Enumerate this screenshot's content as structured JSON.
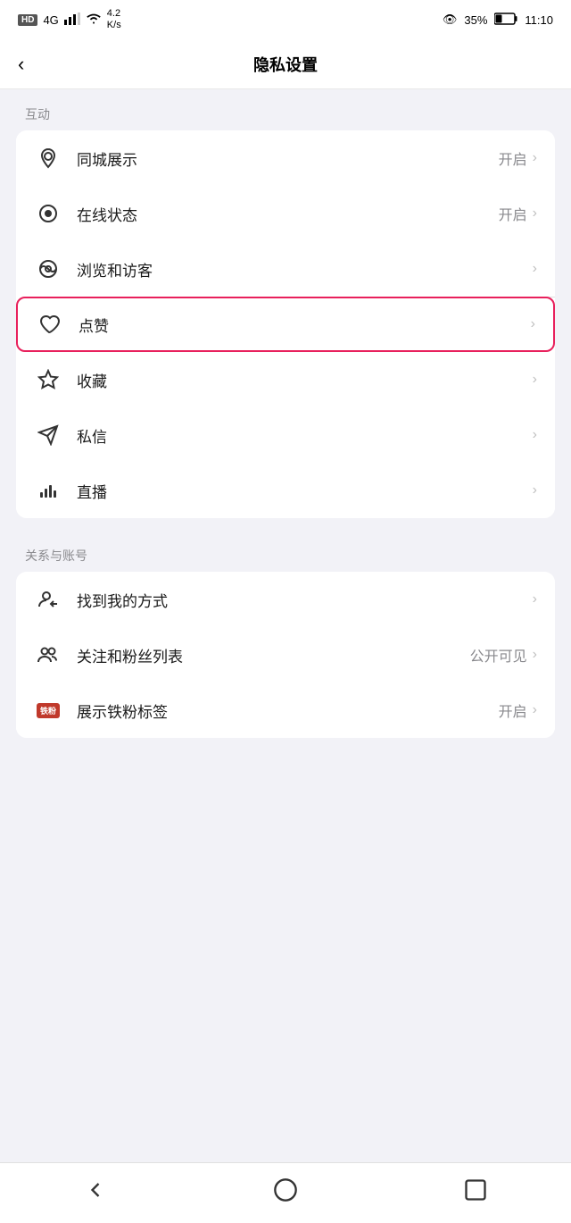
{
  "statusBar": {
    "left": "HD  4G  ↑↓  WiFi  4.2 K/s",
    "eye": "👁",
    "battery": "35%",
    "time": "11:10"
  },
  "header": {
    "back": "‹",
    "title": "隐私设置"
  },
  "sections": [
    {
      "label": "互动",
      "items": [
        {
          "icon": "location",
          "label": "同城展示",
          "value": "开启",
          "chevron": "›",
          "highlighted": false
        },
        {
          "icon": "online",
          "label": "在线状态",
          "value": "开启",
          "chevron": "›",
          "highlighted": false
        },
        {
          "icon": "browse",
          "label": "浏览和访客",
          "value": "",
          "chevron": "›",
          "highlighted": false
        },
        {
          "icon": "like",
          "label": "点赞",
          "value": "",
          "chevron": "›",
          "highlighted": true
        },
        {
          "icon": "star",
          "label": "收藏",
          "value": "",
          "chevron": "›",
          "highlighted": false
        },
        {
          "icon": "message",
          "label": "私信",
          "value": "",
          "chevron": "›",
          "highlighted": false
        },
        {
          "icon": "live",
          "label": "直播",
          "value": "",
          "chevron": "›",
          "highlighted": false
        }
      ]
    },
    {
      "label": "关系与账号",
      "items": [
        {
          "icon": "findme",
          "label": "找到我的方式",
          "value": "",
          "chevron": "›",
          "highlighted": false
        },
        {
          "icon": "follow",
          "label": "关注和粉丝列表",
          "value": "公开可见",
          "chevron": "›",
          "highlighted": false
        },
        {
          "icon": "tiefan",
          "label": "展示铁粉标签",
          "value": "开启",
          "chevron": "›",
          "highlighted": false
        }
      ]
    }
  ],
  "bottomNav": {
    "back": "◁",
    "home": "○",
    "recent": "□"
  }
}
